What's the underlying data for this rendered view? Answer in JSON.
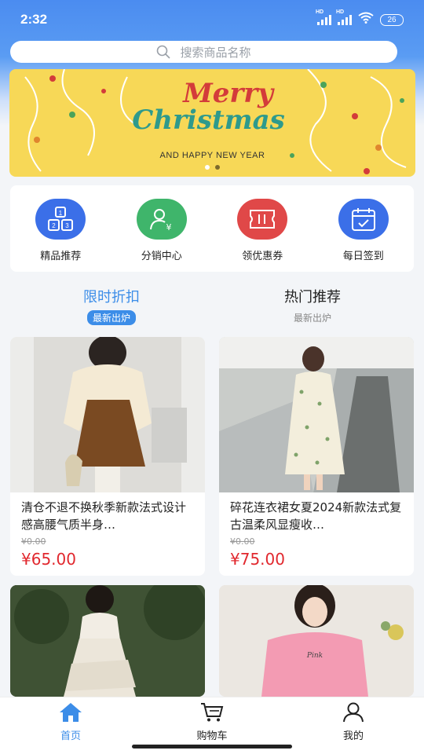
{
  "status_bar": {
    "time": "2:32",
    "hd1": "HD",
    "hd2": "HD",
    "battery": "26"
  },
  "search": {
    "placeholder": "搜索商品名称",
    "icon": "search-icon"
  },
  "banner": {
    "title_line1": "Merry",
    "title_line2": "Christmas",
    "subtitle": "AND HAPPY NEW YEAR",
    "pages": 2,
    "active_page": 1
  },
  "quick_actions": [
    {
      "label": "精品推荐",
      "icon": "grid-blocks-icon",
      "color": "#3b6fe8"
    },
    {
      "label": "分销中心",
      "icon": "user-yen-icon",
      "color": "#3fb56b"
    },
    {
      "label": "领优惠券",
      "icon": "ticket-icon",
      "color": "#e04848"
    },
    {
      "label": "每日签到",
      "icon": "calendar-check-icon",
      "color": "#3b6fe8"
    }
  ],
  "tabs": [
    {
      "title": "限时折扣",
      "sub": "最新出炉",
      "active": true
    },
    {
      "title": "热门推荐",
      "sub": "最新出炉",
      "active": false
    }
  ],
  "products": [
    {
      "title": "清仓不退不换秋季新款法式设计感高腰气质半身…",
      "old_price": "¥0.00",
      "price": "¥65.00"
    },
    {
      "title": "碎花连衣裙女夏2024新款法式复古温柔风显瘦收…",
      "old_price": "¥0.00",
      "price": "¥75.00"
    },
    {
      "title": "",
      "old_price": "",
      "price": ""
    },
    {
      "title": "",
      "old_price": "",
      "price": ""
    }
  ],
  "bottom_nav": [
    {
      "label": "首页",
      "icon": "home-icon",
      "active": true
    },
    {
      "label": "购物车",
      "icon": "cart-icon",
      "active": false
    },
    {
      "label": "我的",
      "icon": "user-icon",
      "active": false
    }
  ],
  "colors": {
    "accent": "#3c8de8",
    "price": "#e1282e",
    "background": "#f3f5f8"
  }
}
